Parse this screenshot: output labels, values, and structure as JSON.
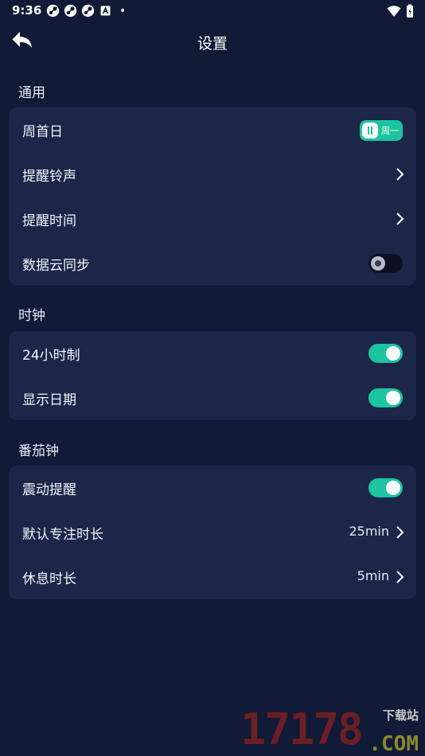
{
  "status_bar": {
    "time": "9:36",
    "notification_icons": [
      "steam-icon",
      "steam-icon",
      "steam-icon",
      "a-app-icon"
    ],
    "dot": "•"
  },
  "header": {
    "title": "设置",
    "back_icon": "back-arrow-icon"
  },
  "sections": {
    "general": {
      "title": "通用",
      "week_start": {
        "label": "周首日",
        "toggle_text": "周一"
      },
      "reminder_ringtone": {
        "label": "提醒铃声"
      },
      "reminder_time": {
        "label": "提醒时间"
      },
      "cloud_sync": {
        "label": "数据云同步",
        "enabled": false
      }
    },
    "clock": {
      "title": "时钟",
      "format_24h": {
        "label": "24小时制",
        "enabled": true
      },
      "show_date": {
        "label": "显示日期",
        "enabled": true
      }
    },
    "pomodoro": {
      "title": "番茄钟",
      "vibrate": {
        "label": "震动提醒",
        "enabled": true
      },
      "focus_duration": {
        "label": "默认专注时长",
        "value": "25min"
      },
      "break_duration": {
        "label": "休息时长",
        "value": "5min"
      }
    }
  },
  "watermark": {
    "number": "17178",
    "domain": ".COM",
    "tag": "下载站"
  },
  "colors": {
    "background": "#111a36",
    "card": "#1b2648",
    "accent": "#1cc5a0"
  }
}
